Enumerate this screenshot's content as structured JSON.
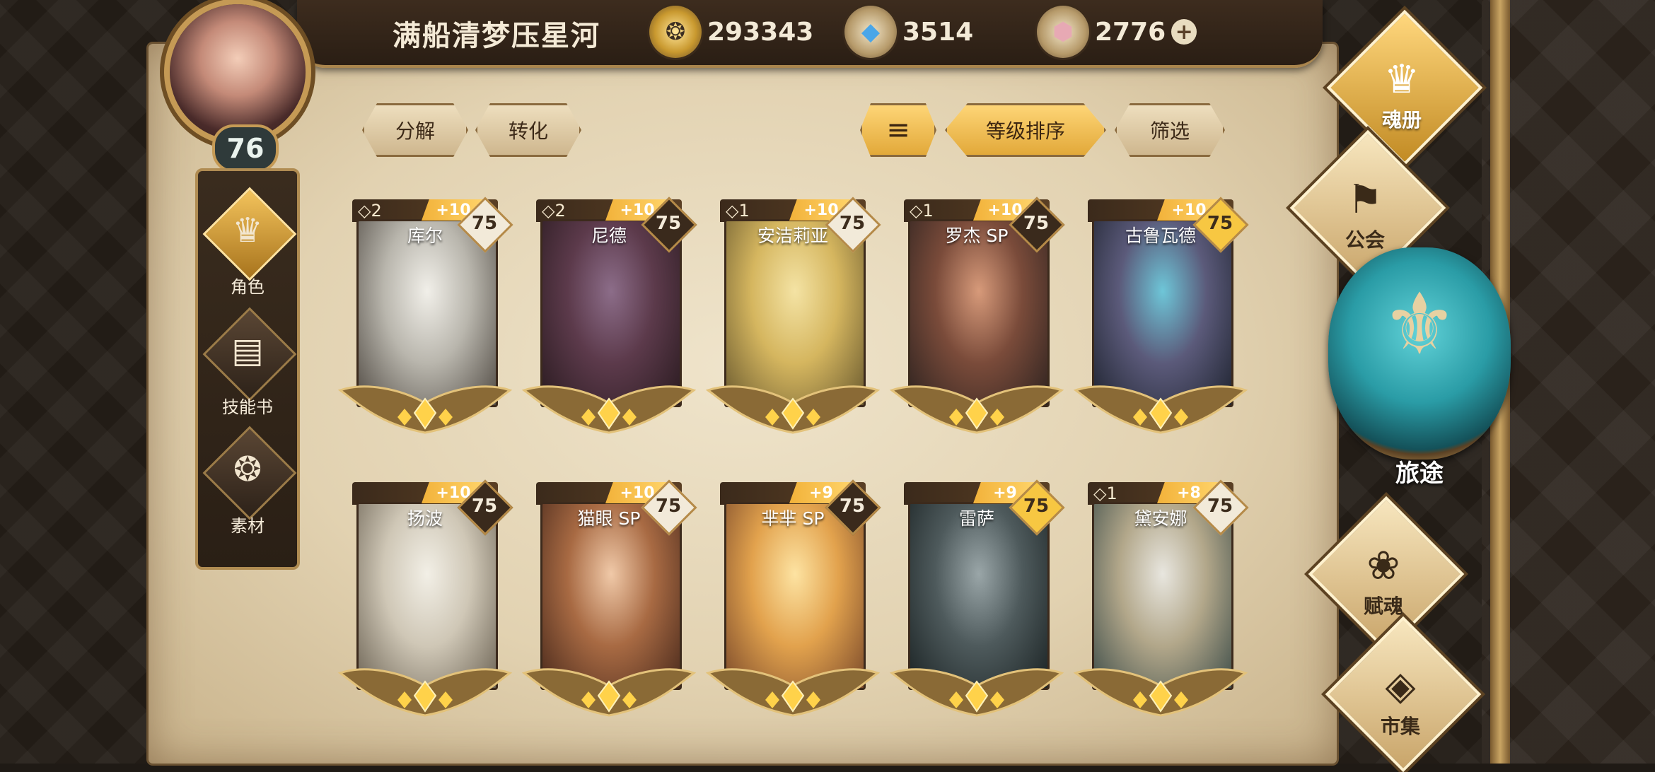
{
  "player": {
    "name": "满船清梦压星河",
    "level": "76"
  },
  "currencies": [
    {
      "icon": "gold-coin-icon",
      "value": "293343"
    },
    {
      "icon": "blue-crystal-icon",
      "value": "3514"
    },
    {
      "icon": "pink-gem-icon",
      "value": "2776",
      "plus": "+"
    }
  ],
  "left_nav": [
    {
      "label": "角色",
      "icon": "character-helmet-icon",
      "glyph": "♛",
      "active": true
    },
    {
      "label": "技能书",
      "icon": "skill-book-icon",
      "glyph": "▤",
      "active": false
    },
    {
      "label": "素材",
      "icon": "material-creature-icon",
      "glyph": "❂",
      "active": false
    }
  ],
  "toolbar": {
    "decompose": "分解",
    "convert": "转化",
    "sort_icon": "sort-lines-icon",
    "sort_by_level": "等级排序",
    "filter": "筛选"
  },
  "heroes": [
    {
      "name": "库尔",
      "stars": "◇2",
      "plus": "+10",
      "level": "75",
      "badge": "light",
      "art": [
        "#f1efe9",
        "#b9b6ad",
        "#514b44"
      ]
    },
    {
      "name": "尼德",
      "stars": "◇2",
      "plus": "+10",
      "level": "75",
      "badge": "dark",
      "art": [
        "#8c6d89",
        "#5c3a4b",
        "#2a1b20"
      ]
    },
    {
      "name": "安洁莉亚",
      "stars": "◇1",
      "plus": "+10",
      "level": "75",
      "badge": "light",
      "art": [
        "#f4e3a4",
        "#d5b65f",
        "#6a5a2f"
      ]
    },
    {
      "name": "罗杰 SP",
      "stars": "◇1",
      "plus": "+10",
      "level": "75",
      "badge": "dark",
      "art": [
        "#d79a7a",
        "#7a4b3a",
        "#2e2320"
      ]
    },
    {
      "name": "古鲁瓦德",
      "stars": "",
      "plus": "+10",
      "level": "75",
      "badge": "gold",
      "art": [
        "#6ec6d8",
        "#5b5a7a",
        "#1f2430"
      ]
    },
    {
      "name": "扬波",
      "stars": "",
      "plus": "+10",
      "level": "75",
      "badge": "dark",
      "art": [
        "#f2efe6",
        "#cfc7b6",
        "#6d6455"
      ]
    },
    {
      "name": "猫眼 SP",
      "stars": "",
      "plus": "+10",
      "level": "75",
      "badge": "light",
      "art": [
        "#f0c9a8",
        "#a86a43",
        "#4a2a1c"
      ]
    },
    {
      "name": "芈芈 SP",
      "stars": "",
      "plus": "+9",
      "level": "75",
      "badge": "dark",
      "art": [
        "#fde3a2",
        "#e2a24d",
        "#7b4a2b"
      ]
    },
    {
      "name": "雷萨",
      "stars": "",
      "plus": "+9",
      "level": "75",
      "badge": "gold",
      "art": [
        "#9aa6a8",
        "#4e5a5c",
        "#1b2324"
      ]
    },
    {
      "name": "黛安娜",
      "stars": "◇1",
      "plus": "+8",
      "level": "75",
      "badge": "light",
      "art": [
        "#e8e6df",
        "#b2a78a",
        "#3f4e4a"
      ]
    }
  ],
  "right_menu": [
    {
      "label": "魂册",
      "icon": "soul-book-icon",
      "glyph": "♛",
      "active": true
    },
    {
      "label": "公会",
      "icon": "guild-banner-icon",
      "glyph": "⚑",
      "active": false
    },
    {
      "label": "赋魂",
      "icon": "soul-swirl-icon",
      "glyph": "❀",
      "active": false
    },
    {
      "label": "市集",
      "icon": "market-gem-icon",
      "glyph": "◈",
      "active": false
    }
  ],
  "journey": {
    "label": "旅途",
    "icon": "journey-emblem-icon"
  }
}
